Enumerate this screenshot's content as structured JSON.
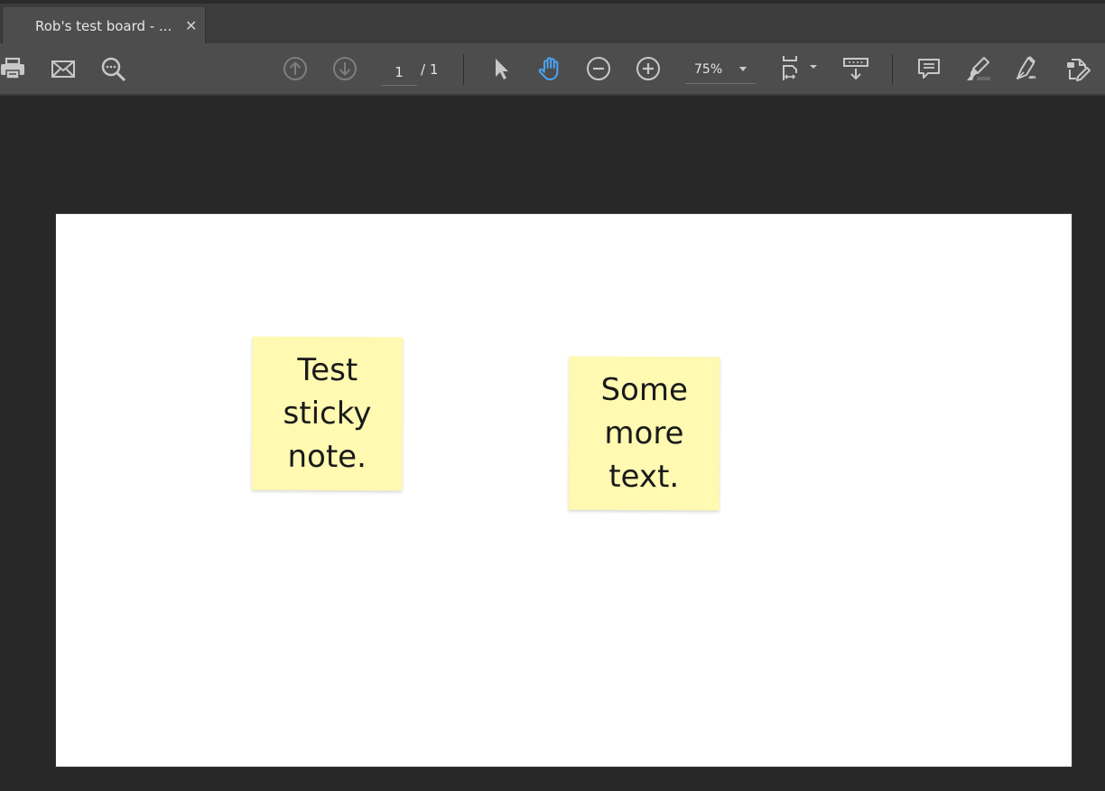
{
  "tab": {
    "title": "Rob's test board - ...",
    "close_icon": "close-icon"
  },
  "toolbar": {
    "left_icons": [
      "print-icon",
      "email-icon",
      "find-text-icon"
    ],
    "prev_page_icon": "arrow-up-circle-icon",
    "next_page_icon": "arrow-down-circle-icon",
    "current_page": "1",
    "page_total": "/ 1",
    "select_tool_icon": "pointer-arrow-icon",
    "hand_tool_icon": "hand-icon",
    "hand_tool_active": true,
    "active_color": "#4aa3f5",
    "zoom_out_icon": "minus-circle-icon",
    "zoom_in_icon": "plus-circle-icon",
    "zoom_level": "75%",
    "right_icons": [
      "fit-page-icon",
      "scroll-mode-icon",
      "comment-icon",
      "highlighter-icon",
      "sign-icon",
      "edit-pdf-icon"
    ]
  },
  "document": {
    "page_color": "#ffffff",
    "sticky_color": "#fff9b1",
    "stickies": [
      {
        "text": "Test\nsticky\nnote."
      },
      {
        "text": "Some\nmore\ntext."
      }
    ]
  }
}
